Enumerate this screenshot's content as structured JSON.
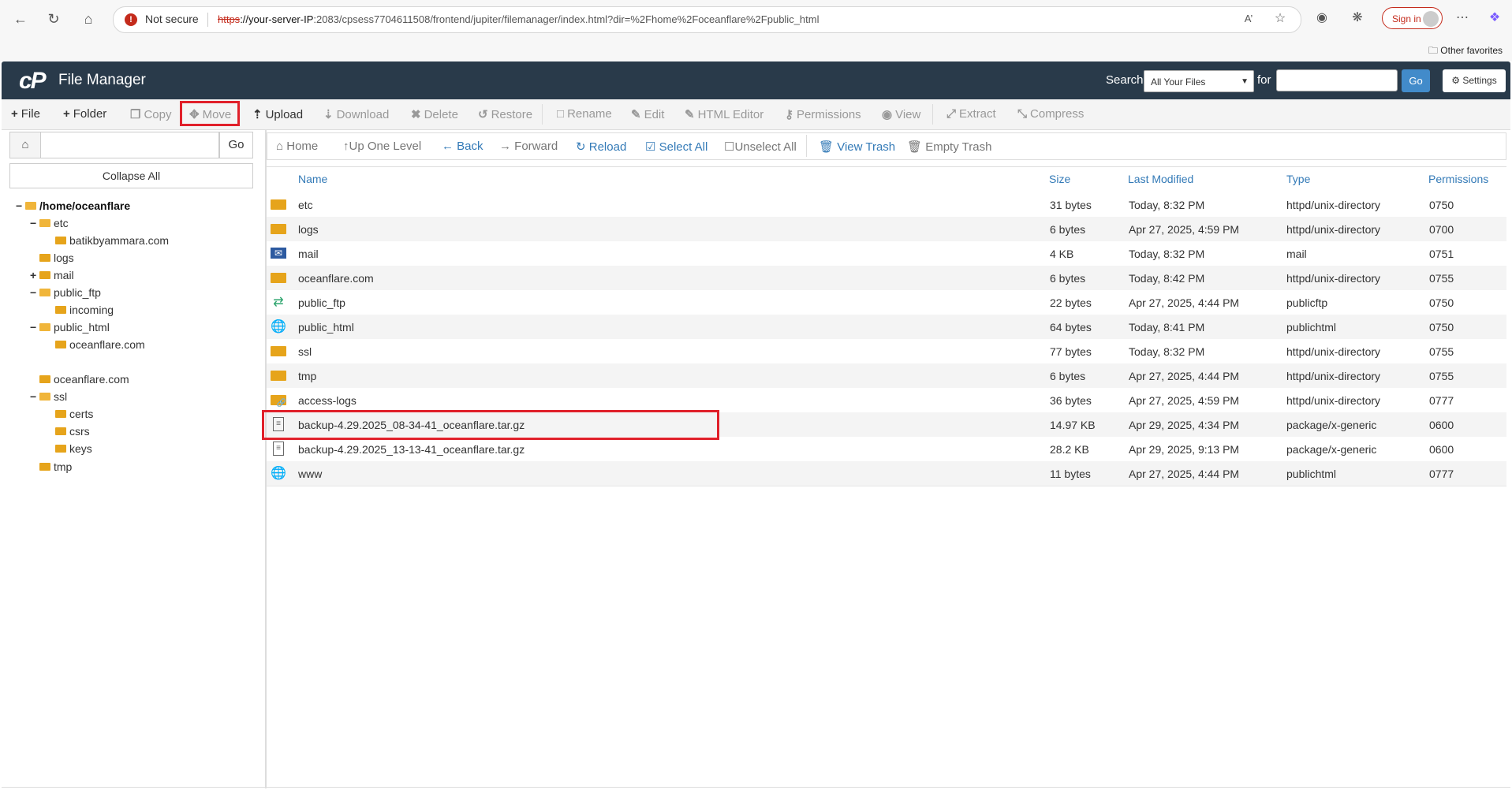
{
  "browser": {
    "not_secure": "Not secure",
    "url_scheme": "https",
    "url_host": "://your-server-IP",
    "url_rest": ":2083/cpsess7704611508/frontend/jupiter/filemanager/index.html?dir=%2Fhome%2Foceanflare%2Fpublic_html",
    "sign_in": "Sign in",
    "other_favorites": "Other favorites"
  },
  "header": {
    "logo": "cP",
    "title": "File Manager",
    "search_label": "Search",
    "search_scope": "All Your Files",
    "for_label": "for",
    "go": "Go",
    "settings": "Settings"
  },
  "toolbar": {
    "file": "File",
    "folder": "Folder",
    "copy": "Copy",
    "move": "Move",
    "upload": "Upload",
    "download": "Download",
    "delete": "Delete",
    "restore": "Restore",
    "rename": "Rename",
    "edit": "Edit",
    "html_editor": "HTML Editor",
    "permissions": "Permissions",
    "view": "View",
    "extract": "Extract",
    "compress": "Compress"
  },
  "left": {
    "go": "Go",
    "collapse_all": "Collapse All",
    "tree": [
      {
        "label": "/home/oceanflare",
        "toggle": "−"
      },
      {
        "label": "etc",
        "toggle": "−"
      },
      {
        "label": "batikbyammara.com",
        "toggle": ""
      },
      {
        "label": "logs",
        "toggle": ""
      },
      {
        "label": "mail",
        "toggle": "+"
      },
      {
        "label": "public_ftp",
        "toggle": "−"
      },
      {
        "label": "incoming",
        "toggle": ""
      },
      {
        "label": "public_html",
        "toggle": "−"
      },
      {
        "label": "oceanflare.com",
        "toggle": ""
      },
      {
        "label": "oceanflare.com",
        "toggle": ""
      },
      {
        "label": "ssl",
        "toggle": "−"
      },
      {
        "label": "certs",
        "toggle": ""
      },
      {
        "label": "csrs",
        "toggle": ""
      },
      {
        "label": "keys",
        "toggle": ""
      },
      {
        "label": "tmp",
        "toggle": ""
      }
    ]
  },
  "subtoolbar": {
    "home": "Home",
    "up_one_level": "Up One Level",
    "back": "Back",
    "forward": "Forward",
    "reload": "Reload",
    "select_all": "Select All",
    "unselect_all": "Unselect All",
    "view_trash": "View Trash",
    "empty_trash": "Empty Trash"
  },
  "table": {
    "headers": {
      "name": "Name",
      "size": "Size",
      "modified": "Last Modified",
      "type": "Type",
      "perms": "Permissions"
    },
    "rows": [
      {
        "icon": "folder-icon",
        "name": "etc",
        "size": "31 bytes",
        "modified": "Today, 8:32 PM",
        "type": "httpd/unix-directory",
        "perms": "0750"
      },
      {
        "icon": "folder-icon",
        "name": "logs",
        "size": "6 bytes",
        "modified": "Apr 27, 2025, 4:59 PM",
        "type": "httpd/unix-directory",
        "perms": "0700"
      },
      {
        "icon": "mail-icon",
        "name": "mail",
        "size": "4 KB",
        "modified": "Today, 8:32 PM",
        "type": "mail",
        "perms": "0751"
      },
      {
        "icon": "folder-icon",
        "name": "oceanflare.com",
        "size": "6 bytes",
        "modified": "Today, 8:42 PM",
        "type": "httpd/unix-directory",
        "perms": "0755"
      },
      {
        "icon": "transfer-icon",
        "name": "public_ftp",
        "size": "22 bytes",
        "modified": "Apr 27, 2025, 4:44 PM",
        "type": "publicftp",
        "perms": "0750"
      },
      {
        "icon": "globe-icon",
        "name": "public_html",
        "size": "64 bytes",
        "modified": "Today, 8:41 PM",
        "type": "publichtml",
        "perms": "0750"
      },
      {
        "icon": "folder-icon",
        "name": "ssl",
        "size": "77 bytes",
        "modified": "Today, 8:32 PM",
        "type": "httpd/unix-directory",
        "perms": "0755"
      },
      {
        "icon": "folder-icon",
        "name": "tmp",
        "size": "6 bytes",
        "modified": "Apr 27, 2025, 4:44 PM",
        "type": "httpd/unix-directory",
        "perms": "0755"
      },
      {
        "icon": "folder-link-icon",
        "name": "access-logs",
        "size": "36 bytes",
        "modified": "Apr 27, 2025, 4:59 PM",
        "type": "httpd/unix-directory",
        "perms": "0777"
      },
      {
        "icon": "archive-icon",
        "name": "backup-4.29.2025_08-34-41_oceanflare.tar.gz",
        "size": "14.97 KB",
        "modified": "Apr 29, 2025, 4:34 PM",
        "type": "package/x-generic",
        "perms": "0600"
      },
      {
        "icon": "archive-icon",
        "name": "backup-4.29.2025_13-13-41_oceanflare.tar.gz",
        "size": "28.2 KB",
        "modified": "Apr 29, 2025, 9:13 PM",
        "type": "package/x-generic",
        "perms": "0600"
      },
      {
        "icon": "globe-link-icon",
        "name": "www",
        "size": "11 bytes",
        "modified": "Apr 27, 2025, 4:44 PM",
        "type": "publichtml",
        "perms": "0777"
      }
    ]
  },
  "colors": {
    "header_bg": "#293a4a",
    "link_blue": "#337ab7",
    "highlight_red": "#e0202a",
    "folder_yellow": "#e6a41b",
    "go_blue": "#428bca"
  }
}
